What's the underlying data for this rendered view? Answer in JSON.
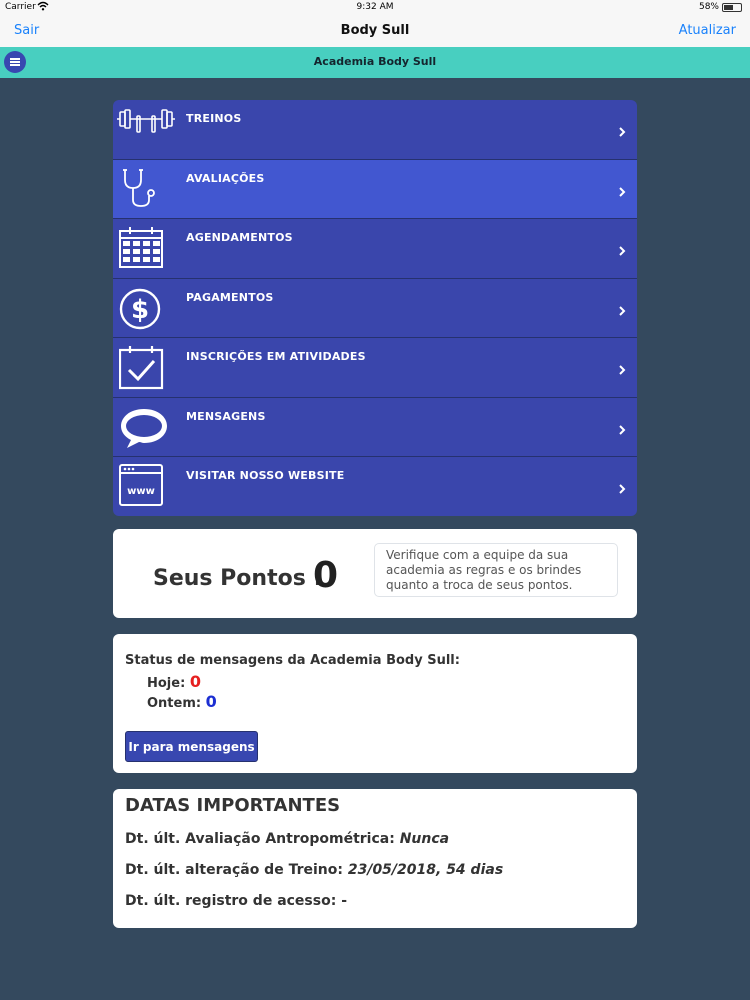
{
  "status_bar": {
    "carrier": "Carrier",
    "time": "9:32 AM",
    "battery": "58%",
    "battery_level": 0.58
  },
  "nav": {
    "left_button": "Sair",
    "title": "Body Sull",
    "right_button": "Atualizar"
  },
  "subbar": {
    "title": "Academia Body Sull"
  },
  "menu": {
    "items": [
      {
        "label": "TREINOS",
        "icon": "dumbbell-icon"
      },
      {
        "label": "AVALIAÇÕES",
        "icon": "stethoscope-icon"
      },
      {
        "label": "AGENDAMENTOS",
        "icon": "calendar-icon"
      },
      {
        "label": "PAGAMENTOS",
        "icon": "dollar-icon"
      },
      {
        "label": "INSCRIÇÕES EM ATIVIDADES",
        "icon": "calendar-check-icon"
      },
      {
        "label": "MENSAGENS",
        "icon": "speech-bubble-icon"
      },
      {
        "label": "VISITAR NOSSO WEBSITE",
        "icon": "www-icon"
      }
    ]
  },
  "points": {
    "label": "Seus Pontos :",
    "value": "0",
    "note": "Verifique com a equipe da sua academia as regras e os brindes quanto a troca de seus pontos."
  },
  "messages": {
    "heading": "Status de mensagens da Academia Body Sull:",
    "today_label": "Hoje:",
    "today_value": "0",
    "yesterday_label": "Ontem:",
    "yesterday_value": "0",
    "button": "Ir para mensagens"
  },
  "dates": {
    "heading": "DATAS IMPORTANTES",
    "line1_label": "Dt. últ. Avaliação Antropométrica:",
    "line1_value": "Nunca",
    "line2_label": "Dt. últ. alteração de Treino:",
    "line2_value": "23/05/2018, 54 dias",
    "line3_label": "Dt. últ. registro de acesso:",
    "line3_value": "-"
  },
  "colors": {
    "background": "#34495e",
    "teal_bar": "#48cfc0",
    "menu": "#3a46ac",
    "menu_active": "#4257d0",
    "link": "#1a82fb"
  }
}
